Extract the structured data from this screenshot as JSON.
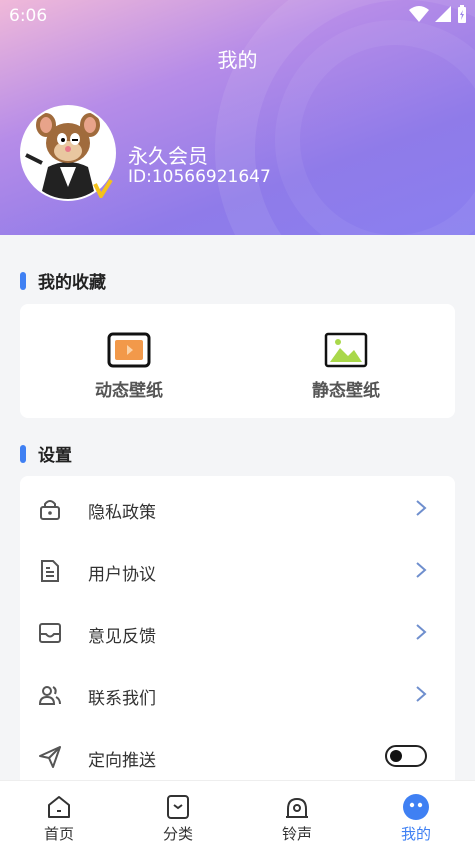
{
  "status_bar": {
    "time": "6:06"
  },
  "header": {
    "title": "我的"
  },
  "user": {
    "name": "永久会员",
    "id": "ID:10566921647"
  },
  "favorites": {
    "title": "我的收藏",
    "items": [
      {
        "label": "动态壁纸",
        "icon": "video-wallpaper-icon"
      },
      {
        "label": "静态壁纸",
        "icon": "image-wallpaper-icon"
      }
    ]
  },
  "settings": {
    "title": "设置",
    "items": [
      {
        "label": "隐私政策",
        "icon": "lock-icon"
      },
      {
        "label": "用户协议",
        "icon": "document-icon"
      },
      {
        "label": "意见反馈",
        "icon": "inbox-icon"
      },
      {
        "label": "联系我们",
        "icon": "contacts-icon"
      },
      {
        "label": "定向推送",
        "icon": "send-icon",
        "toggle": false
      }
    ]
  },
  "tabbar": {
    "items": [
      {
        "label": "首页",
        "icon": "home-icon"
      },
      {
        "label": "分类",
        "icon": "category-icon"
      },
      {
        "label": "铃声",
        "icon": "ringtone-icon"
      },
      {
        "label": "我的",
        "icon": "profile-icon",
        "active": true
      }
    ]
  },
  "colors": {
    "accent": "#3f80f3",
    "header_start": "#f0b9d9",
    "header_end": "#8a7ff0"
  }
}
